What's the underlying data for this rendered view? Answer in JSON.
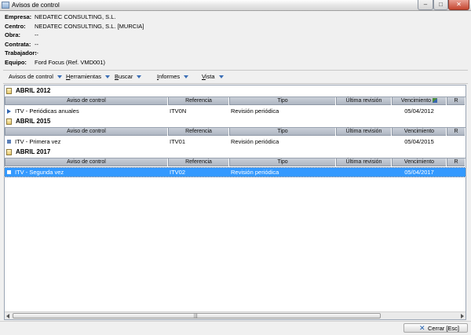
{
  "window": {
    "title": "Avisos de control",
    "min_glyph": "–",
    "max_glyph": "□",
    "close_glyph": "✕"
  },
  "info": {
    "empresa_label": "Empresa:",
    "empresa_value": "NEDATEC CONSULTING, S.L.",
    "centro_label": "Centro:",
    "centro_value": "NEDATEC CONSULTING, S.L. [MURCIA]",
    "obra_label": "Obra:",
    "obra_value": "--",
    "contrata_label": "Contrata:",
    "contrata_value": "--",
    "trabajador_label": "Trabajador:",
    "trabajador_value": "--",
    "equipo_label": "Equipo:",
    "equipo_value": "Ford Focus (Ref. VMD001)"
  },
  "toolbar": {
    "avisos_label": "Avisos de control",
    "herramientas_ul": "H",
    "herramientas_rest": "erramientas",
    "buscar_ul": "B",
    "buscar_rest": "uscar",
    "informes_ul": "I",
    "informes_rest": "nformes",
    "vista_ul": "V",
    "vista_rest": "ista"
  },
  "columns": {
    "aviso": "Aviso de control",
    "referencia": "Referencia",
    "tipo": "Tipo",
    "ultima": "Última revisión",
    "vencimiento": "Vencimiento",
    "r": "R"
  },
  "groups": [
    {
      "title": "ABRIL 2012",
      "row": {
        "aviso": "ITV - Periódicas anuales",
        "referencia": "ITV0N",
        "tipo": "Revisión periódica",
        "ultima": "",
        "vencimiento": "05/04/2012"
      }
    },
    {
      "title": "ABRIL 2015",
      "row": {
        "aviso": "ITV - Primera vez",
        "referencia": "ITV01",
        "tipo": "Revisión periódica",
        "ultima": "",
        "vencimiento": "05/04/2015"
      }
    },
    {
      "title": "ABRIL 2017",
      "row": {
        "aviso": "ITV - Segunda vez",
        "referencia": "ITV02",
        "tipo": "Revisión periódica",
        "ultima": "",
        "vencimiento": "05/04/2017"
      }
    }
  ],
  "scrollbar": {
    "grip": "|||"
  },
  "footer": {
    "close_icon": "✕",
    "close_label": "Cerrar  [Esc]"
  },
  "colors": {
    "selection": "#3399ff",
    "accent": "#3a6eb5"
  }
}
